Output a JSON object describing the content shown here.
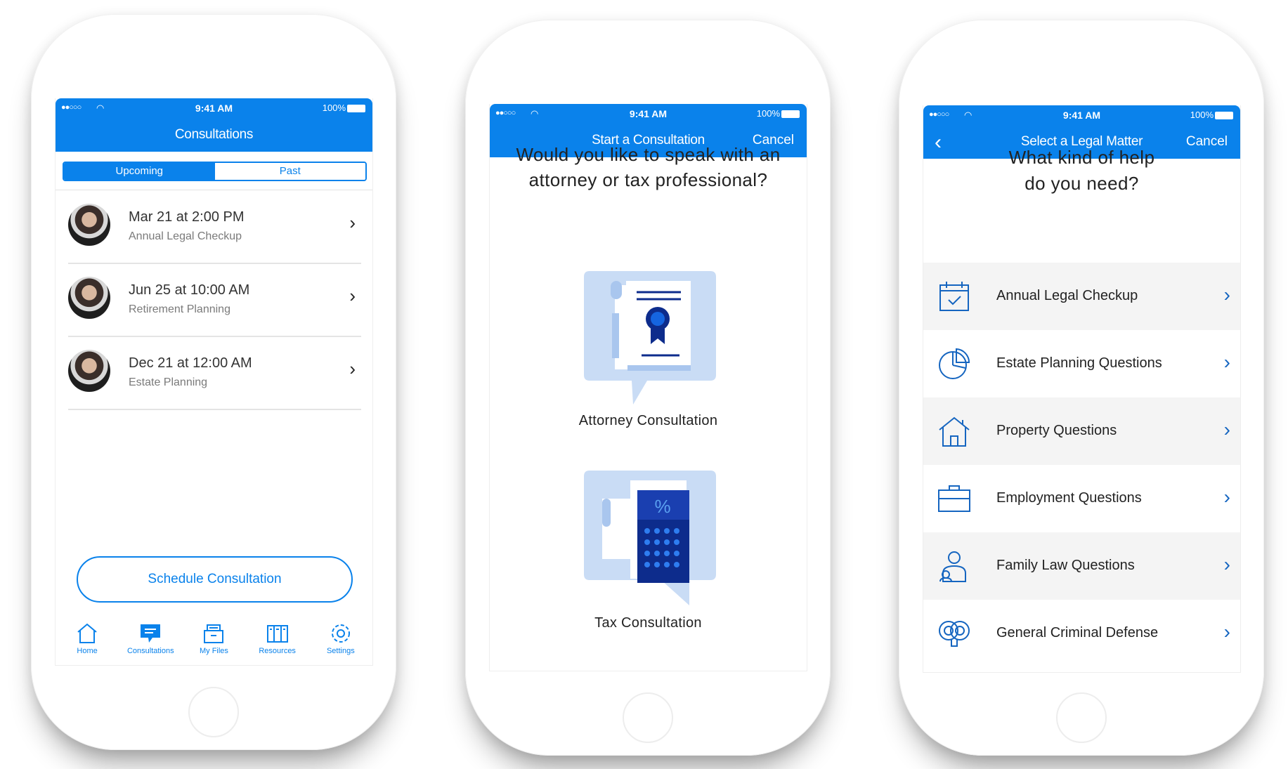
{
  "status_bar": {
    "signal": "●●○○○",
    "time": "9:41 AM",
    "battery": "100%"
  },
  "screen1": {
    "title": "Consultations",
    "segments": [
      "Upcoming",
      "Past"
    ],
    "consultations": [
      {
        "date": "Mar 21 at 2:00 PM",
        "type": "Annual Legal Checkup"
      },
      {
        "date": "Jun 25 at 10:00 AM",
        "type": "Retirement Planning"
      },
      {
        "date": "Dec 21 at 12:00 AM",
        "type": "Estate Planning"
      }
    ],
    "schedule_button": "Schedule Consultation",
    "tabs": [
      "Home",
      "Consultations",
      "My Files",
      "Resources",
      "Settings"
    ]
  },
  "screen2": {
    "title": "Start a Consultation",
    "cancel": "Cancel",
    "question_line1": "Would you like to speak with an",
    "question_line2": "attorney or tax professional?",
    "options": [
      "Attorney Consultation",
      "Tax Consultation"
    ]
  },
  "screen3": {
    "title": "Select a Legal Matter",
    "cancel": "Cancel",
    "question_line1": "What kind of help",
    "question_line2": "do you need?",
    "matters": [
      {
        "label": "Annual Legal Checkup",
        "icon": "calendar-check-icon"
      },
      {
        "label": "Estate Planning Questions",
        "icon": "pie-chart-icon"
      },
      {
        "label": "Property Questions",
        "icon": "house-icon"
      },
      {
        "label": "Employment Questions",
        "icon": "briefcase-icon"
      },
      {
        "label": "Family Law Questions",
        "icon": "family-icon"
      },
      {
        "label": "General Criminal Defense",
        "icon": "handcuffs-icon"
      }
    ]
  },
  "colors": {
    "accent": "#0a82eb",
    "illustration_light": "#c9dcf5",
    "illustration_dark": "#0d2c8c"
  }
}
